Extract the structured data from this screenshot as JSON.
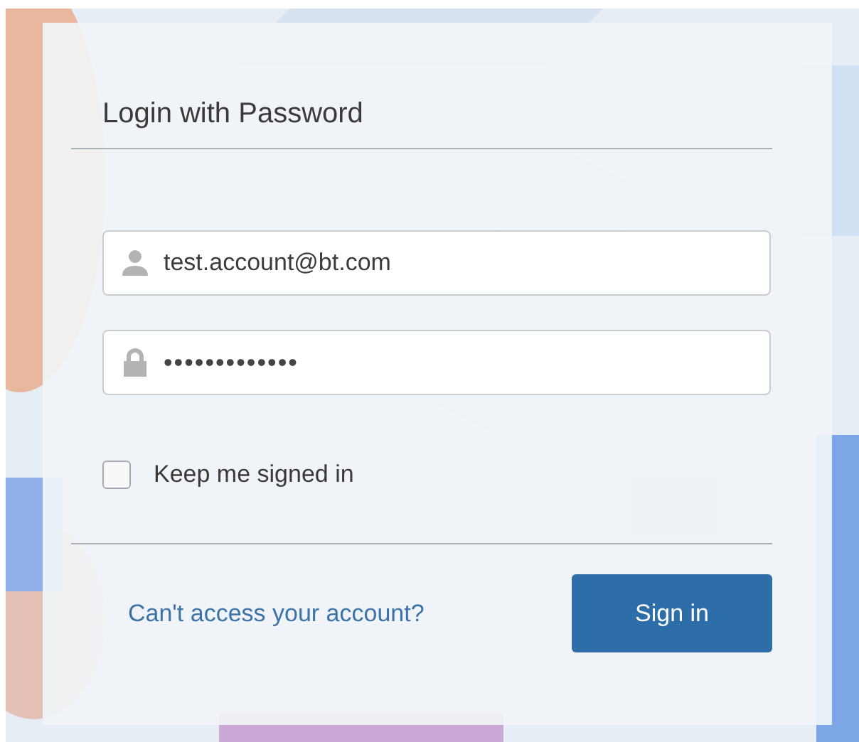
{
  "title": "Login with Password",
  "fields": [
    {
      "kind": "user",
      "value": "test.account@bt.com"
    },
    {
      "kind": "password",
      "value": "•••••••••••••"
    }
  ],
  "remember": {
    "label": "Keep me signed in",
    "checked": false
  },
  "help_link": "Can't access your account?",
  "buttons": [
    "Sign in"
  ]
}
